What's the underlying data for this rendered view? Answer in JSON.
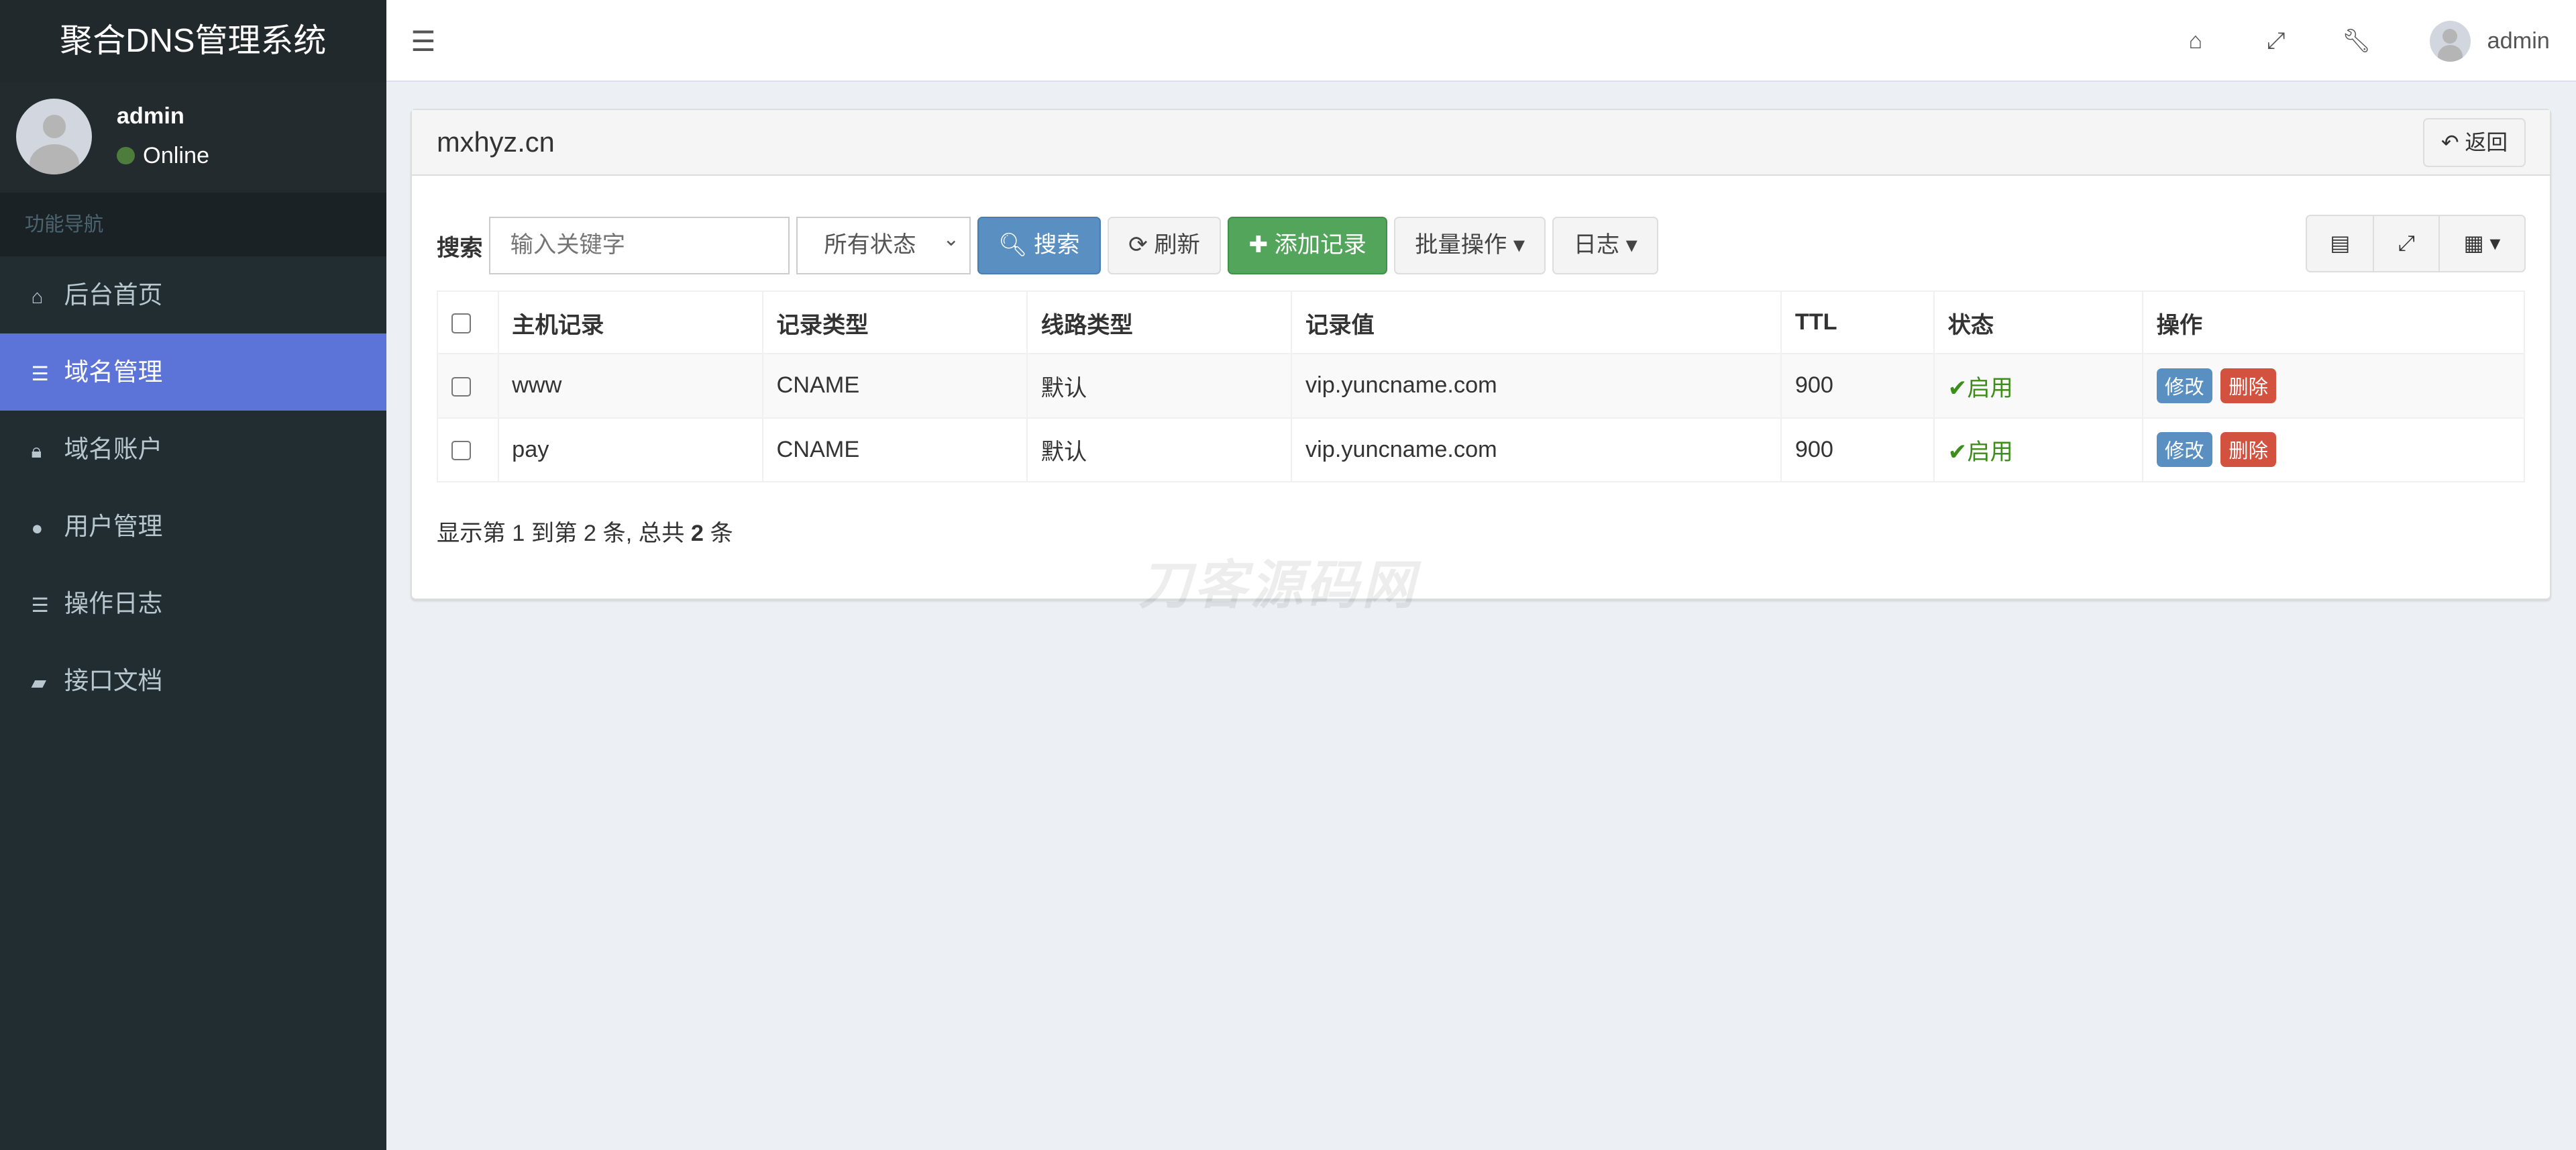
{
  "app": {
    "title": "聚合DNS管理系统"
  },
  "user": {
    "name": "admin",
    "status": "Online",
    "status_color": "#4e7c3c"
  },
  "sidebar": {
    "header": "功能导航",
    "items": [
      {
        "label": "后台首页",
        "icon": "home-icon",
        "active": false
      },
      {
        "label": "域名管理",
        "icon": "list-icon",
        "active": true
      },
      {
        "label": "域名账户",
        "icon": "lock-icon",
        "active": false
      },
      {
        "label": "用户管理",
        "icon": "user-icon",
        "active": false
      },
      {
        "label": "操作日志",
        "icon": "list-alt-icon",
        "active": false
      },
      {
        "label": "接口文档",
        "icon": "book-icon",
        "active": false
      }
    ]
  },
  "topbar": {
    "user": "admin",
    "icons": [
      "home-icon",
      "expand-icon",
      "wrench-icon"
    ]
  },
  "panel": {
    "title": "mxhyz.cn",
    "back_label": "返回"
  },
  "toolbar": {
    "search_label": "搜索",
    "search_placeholder": "输入关键字",
    "status_select": "所有状态",
    "search_btn": "搜索",
    "refresh_btn": "刷新",
    "add_btn": "添加记录",
    "batch_btn": "批量操作",
    "log_btn": "日志"
  },
  "table": {
    "columns": [
      "主机记录",
      "记录类型",
      "线路类型",
      "记录值",
      "TTL",
      "状态",
      "操作"
    ],
    "rows": [
      {
        "host": "www",
        "type": "CNAME",
        "line": "默认",
        "value": "vip.yuncname.com",
        "ttl": "900",
        "status": "启用"
      },
      {
        "host": "pay",
        "type": "CNAME",
        "line": "默认",
        "value": "vip.yuncname.com",
        "ttl": "900",
        "status": "启用"
      }
    ],
    "edit_label": "修改",
    "delete_label": "删除"
  },
  "pagination": {
    "pre": "显示第 1 到第 2 条, 总共 ",
    "total": "2",
    "post": " 条"
  },
  "watermark": "刀客源码网",
  "colors": {
    "accent": "#5c73d8",
    "sidebar": "#222d32",
    "primary": "#5a8fc2",
    "success": "#53a55c",
    "danger": "#d2513f"
  }
}
